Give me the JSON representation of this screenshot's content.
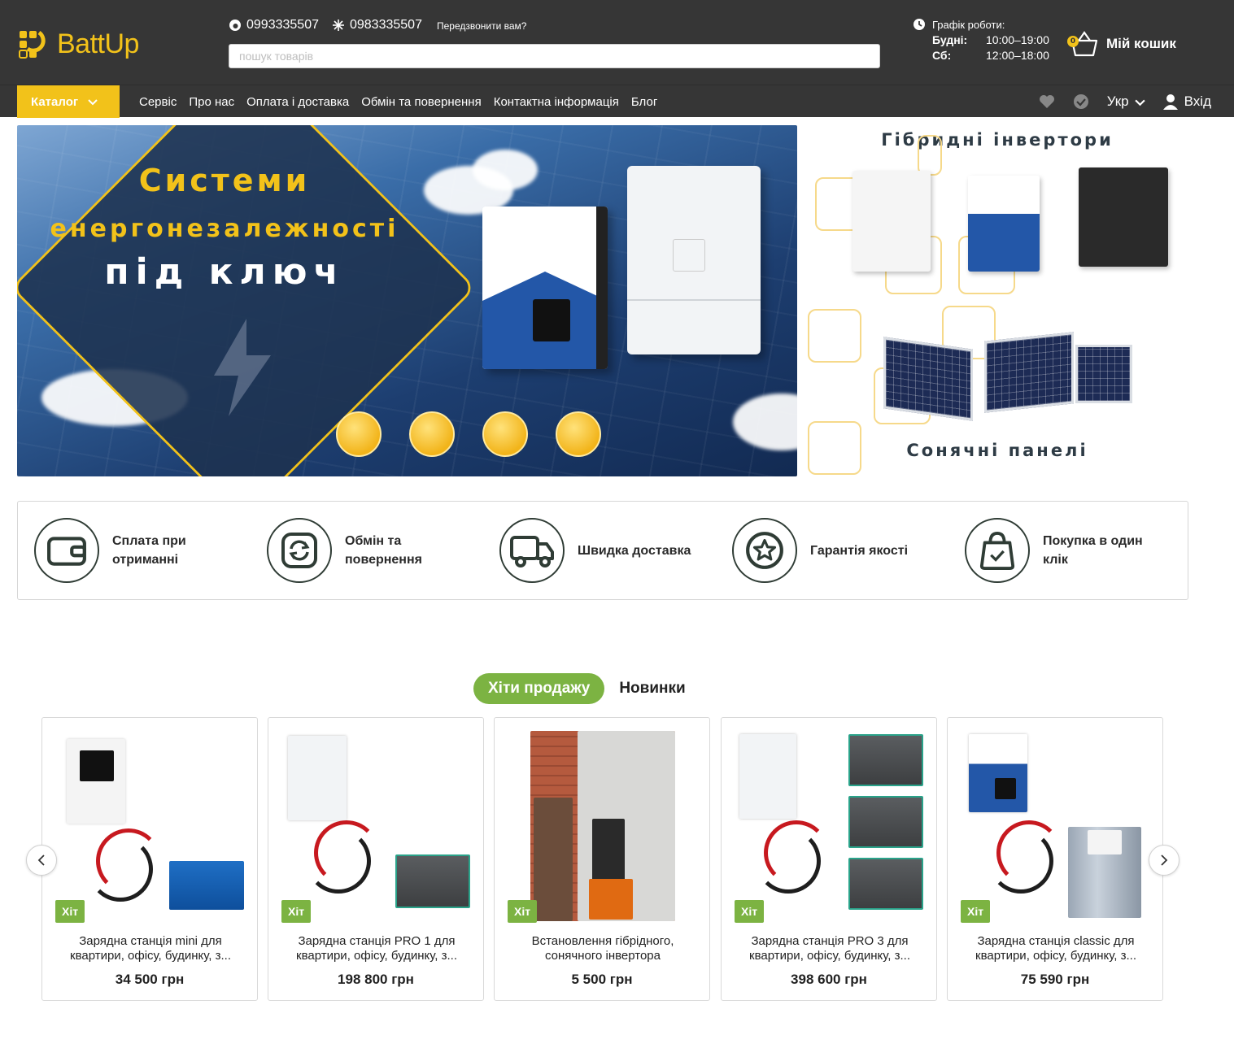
{
  "brand": {
    "name": "BattUp"
  },
  "header": {
    "phone_1": "0993335507",
    "phone_2": "0983335507",
    "callback": "Передзвонити вам?",
    "search_placeholder": "пошук товарів",
    "schedule_title": "Графік роботи:",
    "schedule": [
      {
        "day": "Будні:",
        "hours": "10:00–19:00"
      },
      {
        "day": "Сб:",
        "hours": "12:00–18:00"
      }
    ],
    "cart_label": "Мій кошик",
    "cart_count": "0"
  },
  "nav": {
    "catalog": "Каталог",
    "links": [
      "Сервіс",
      "Про нас",
      "Оплата і доставка",
      "Обмін та повернення",
      "Контактна інформація",
      "Блог"
    ],
    "language": "Укр",
    "login": "Вхід"
  },
  "banner_main": {
    "line1": "Системи",
    "line2": "енергонезалежності",
    "line3": "під ключ"
  },
  "banner_side": {
    "top_title": "Гібридні інвертори",
    "bottom_title": "Сонячні панелі"
  },
  "features": [
    {
      "label": "Сплата при отриманні",
      "icon": "wallet-icon"
    },
    {
      "label": "Обмін та повернення",
      "icon": "exchange-icon"
    },
    {
      "label": "Швидка доставка",
      "icon": "truck-icon"
    },
    {
      "label": "Гарантія якості",
      "icon": "quality-star-icon"
    },
    {
      "label": "Покупка в один клік",
      "icon": "shopping-bag-icon"
    }
  ],
  "tabs": {
    "active": "Хіти продажу",
    "other": "Новинки"
  },
  "products": [
    {
      "badge": "Хіт",
      "name": "Зарядна станція mini для квартири, офісу, будинку, з...",
      "price": "34 500 грн"
    },
    {
      "badge": "Хіт",
      "name": "Зарядна станція PRO 1 для квартири, офісу, будинку, з...",
      "price": "198 800 грн"
    },
    {
      "badge": "Хіт",
      "name": "Встановлення гібрідного, сонячного інвертора",
      "price": "5 500 грн"
    },
    {
      "badge": "Хіт",
      "name": "Зарядна станція PRO 3 для квартири, офісу, будинку, з...",
      "price": "398 600 грн"
    },
    {
      "badge": "Хіт",
      "name": "Зарядна станція classic для квартири, офісу, будинку, з...",
      "price": "75 590 грн"
    }
  ],
  "colors": {
    "accent": "#f2c21a",
    "header_bg": "#363636",
    "green": "#7cb342"
  }
}
